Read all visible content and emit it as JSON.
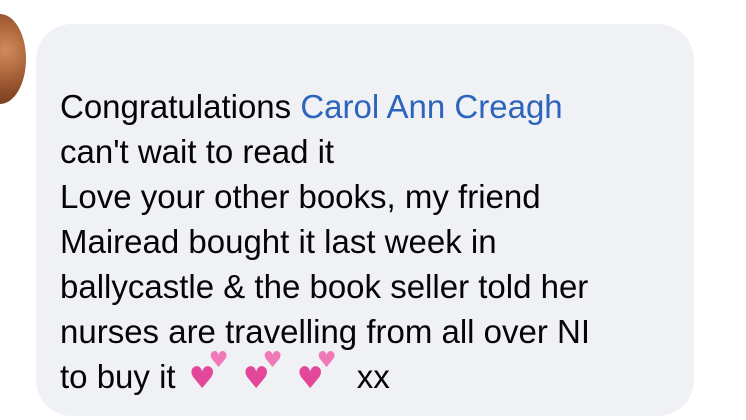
{
  "comment": {
    "intro_text": "Congratulations ",
    "mention": "Carol Ann Creagh",
    "line2": "can't wait to read it",
    "line3": "Love your other books, my friend",
    "line4": "Mairead bought it last week in",
    "line5": "ballycastle & the book seller told her",
    "line6": "nurses are travelling from all over NI",
    "line7_prefix": "to  buy it",
    "line7_suffix": "xx",
    "emoji": [
      "two-hearts-emoji",
      "two-hearts-emoji",
      "two-hearts-emoji"
    ]
  },
  "colors": {
    "bubble_background": "#f0f1f4",
    "mention_link": "#2d64bc",
    "text": "#050505",
    "heart_pink": "#e3479a"
  },
  "icons": {
    "avatar": "user-avatar"
  }
}
